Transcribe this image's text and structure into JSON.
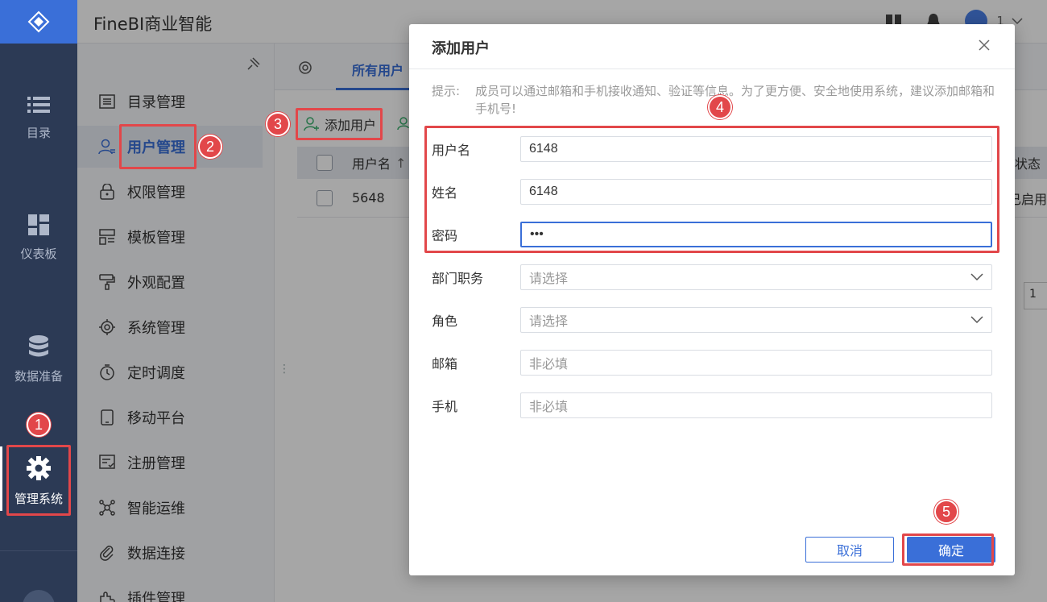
{
  "app": {
    "title": "FineBI商业智能",
    "user_num": "1"
  },
  "rail": {
    "items": [
      {
        "label": "目录",
        "icon": "list-icon"
      },
      {
        "label": "仪表板",
        "icon": "dashboard-icon"
      },
      {
        "label": "数据准备",
        "icon": "database-icon"
      },
      {
        "label": "管理系统",
        "icon": "gear-icon"
      }
    ]
  },
  "subnav": {
    "items": [
      {
        "label": "目录管理",
        "icon": "catalog-icon"
      },
      {
        "label": "用户管理",
        "icon": "user-icon"
      },
      {
        "label": "权限管理",
        "icon": "lock-icon"
      },
      {
        "label": "模板管理",
        "icon": "template-icon"
      },
      {
        "label": "外观配置",
        "icon": "brush-icon"
      },
      {
        "label": "系统管理",
        "icon": "settings-icon"
      },
      {
        "label": "定时调度",
        "icon": "timer-icon"
      },
      {
        "label": "移动平台",
        "icon": "mobile-icon"
      },
      {
        "label": "注册管理",
        "icon": "register-icon"
      },
      {
        "label": "智能运维",
        "icon": "ops-icon"
      },
      {
        "label": "数据连接",
        "icon": "link-icon"
      },
      {
        "label": "插件管理",
        "icon": "plugin-icon"
      }
    ]
  },
  "main": {
    "tab_all": "所有用户",
    "add_user": "添加用户",
    "table": {
      "header_username": "用户名",
      "header_status": "状态",
      "row_username": "5648",
      "row_status": "已启用",
      "pager_text": "1"
    }
  },
  "modal": {
    "title": "添加用户",
    "hint_label": "提示:",
    "hint_text": "成员可以通过邮箱和手机接收通知、验证等信息。为了更方便、安全地使用系统，建议添加邮箱和手机号!",
    "fields": {
      "username": {
        "label": "用户名",
        "value": "6148"
      },
      "realname": {
        "label": "姓名",
        "value": "6148"
      },
      "password": {
        "label": "密码",
        "value": "•••"
      },
      "department": {
        "label": "部门职务",
        "placeholder": "请选择"
      },
      "role": {
        "label": "角色",
        "placeholder": "请选择"
      },
      "email": {
        "label": "邮箱",
        "placeholder": "非必填"
      },
      "phone": {
        "label": "手机",
        "placeholder": "非必填"
      }
    },
    "cancel": "取消",
    "ok": "确定"
  },
  "annotations": [
    "1",
    "2",
    "3",
    "4",
    "5"
  ],
  "colors": {
    "accent": "#3a6fd8",
    "highlight": "#e2474a",
    "rail": "#2c3a55"
  }
}
